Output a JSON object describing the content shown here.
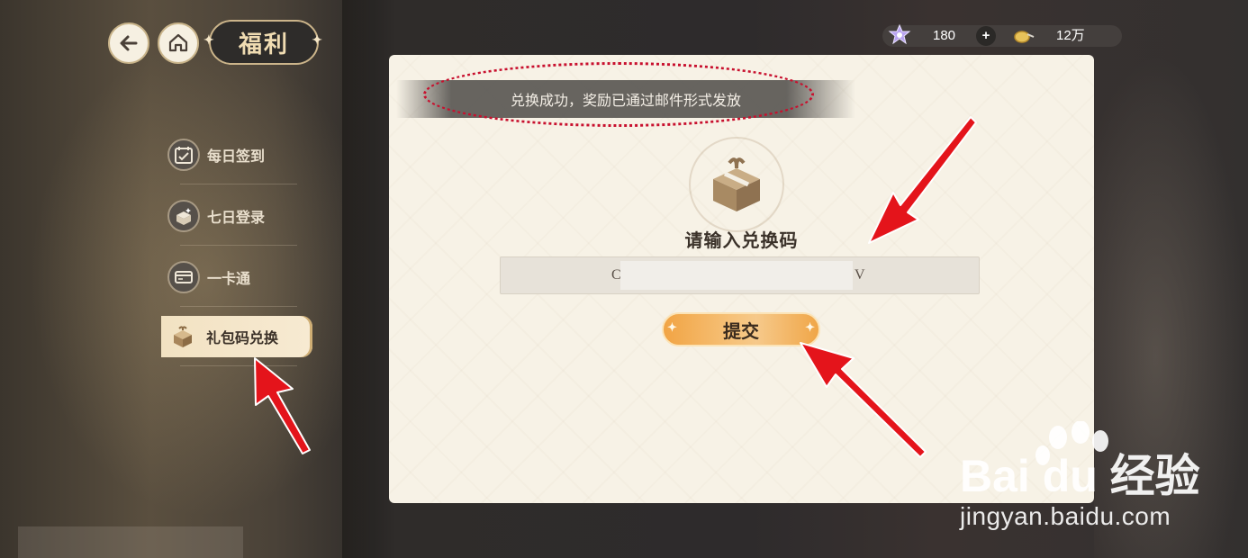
{
  "header": {
    "title": "福利",
    "back_icon": "back-arrow-icon",
    "home_icon": "home-icon"
  },
  "currency": {
    "gem_count": "180",
    "plus_label": "+",
    "coin_count": "12万"
  },
  "sidebar": {
    "items": [
      {
        "label": "每日签到",
        "icon": "calendar-check-icon",
        "active": false
      },
      {
        "label": "七日登录",
        "icon": "gift-box-sparkle-icon",
        "active": false
      },
      {
        "label": "一卡通",
        "icon": "card-icon",
        "active": false
      },
      {
        "label": "礼包码兑换",
        "icon": "gift-icon",
        "active": true
      }
    ]
  },
  "panel": {
    "toast": "兑换成功，奖励已通过邮件形式发放",
    "prompt": "请输入兑换码",
    "code_left": "C",
    "code_right": "V",
    "submit_label": "提交"
  },
  "watermark": {
    "brand": "Bai du 经验",
    "url": "jingyan.baidu.com"
  },
  "colors": {
    "annotation": "#e4141b",
    "accent": "#f1a444",
    "panel_bg": "#f7f2e6"
  }
}
